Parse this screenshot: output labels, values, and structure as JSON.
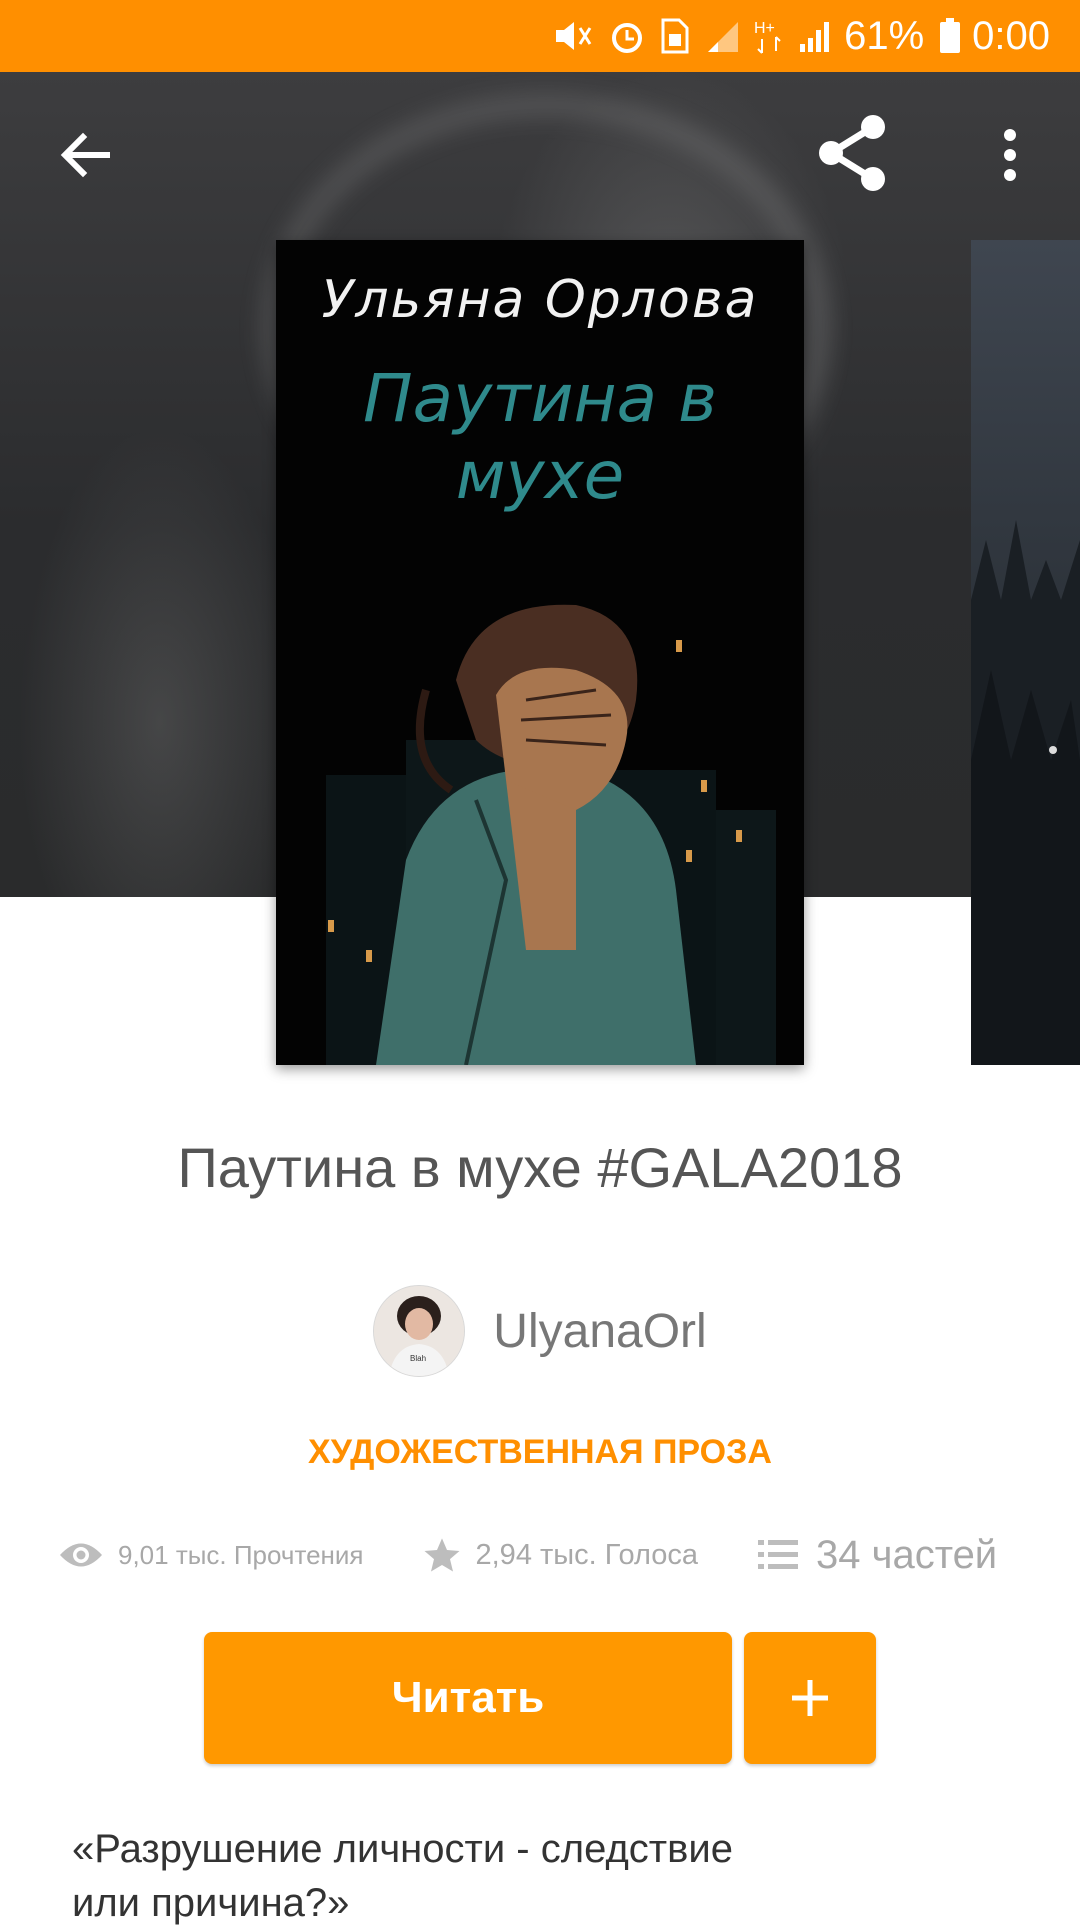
{
  "status_bar": {
    "battery": "61%",
    "time": "0:00",
    "icons": [
      "mute-icon",
      "alarm-icon",
      "sim-icon",
      "signal-icon",
      "hplus-icon",
      "signal-icon",
      "battery-icon"
    ]
  },
  "toolbar": {
    "back_icon": "arrow-left-icon",
    "share_icon": "share-icon",
    "more_icon": "more-vertical-icon"
  },
  "cover": {
    "author_text": "Ульяна Орлова",
    "title_text": "Паутина в мухе"
  },
  "book": {
    "title": "Паутина в мухе #GALA2018",
    "author": "UlyanaOrl",
    "category": "ХУДОЖЕСТВЕННАЯ ПРОЗА"
  },
  "stats": {
    "reads": "9,01 тыс. Прочтения",
    "votes": "2,94 тыс. Голоса",
    "parts": "34 частей"
  },
  "actions": {
    "read_label": "Читать",
    "add_label": "+"
  },
  "description": {
    "line1": "«Разрушение личности - следствие",
    "line2": "или причина?»"
  },
  "colors": {
    "accent": "#FF9800",
    "status_bar": "#FF8F00",
    "cover_title": "#2f8a8c"
  }
}
